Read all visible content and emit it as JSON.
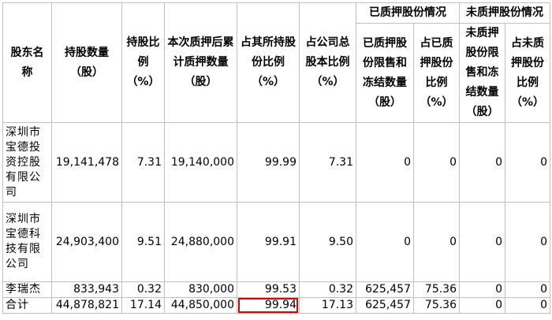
{
  "table": {
    "headers": {
      "shareholder_name": "股东名称",
      "shares_held": "持股数量（股）",
      "holding_ratio": "持股比例（%）",
      "cumulative_pledged": "本次质押后累计质押数量（股）",
      "pct_of_own_holding": "占其所持股份比例（%）",
      "pct_of_total_capital": "占公司总股本比例（%）",
      "pledged_group": "已质押股份情况",
      "unpledged_group": "未质押股份情况",
      "pledged_restricted_frozen": "已质押股份限售和冻结数量（股）",
      "pledged_ratio": "占已质押股份比例（%）",
      "unpledged_restricted_frozen": "未质押股份限售和冻结数量（股）",
      "unpledged_ratio": "占未质押股份比例（%）"
    },
    "rows": [
      {
        "name": "深圳市宝德投资控股有限公司",
        "shares": "19,141,478",
        "ratio": "7.31",
        "pledged": "19,140,000",
        "pct_own": "99.99",
        "pct_total": "7.31",
        "p_restricted": "0",
        "p_ratio": "0",
        "u_restricted": "0",
        "u_ratio": "0"
      },
      {
        "name": "深圳市宝德科技有限公司",
        "shares": "24,903,400",
        "ratio": "9.51",
        "pledged": "24,880,000",
        "pct_own": "99.91",
        "pct_total": "9.50",
        "p_restricted": "0",
        "p_ratio": "0",
        "u_restricted": "0",
        "u_ratio": "0"
      },
      {
        "name": "李瑞杰",
        "shares": "833,943",
        "ratio": "0.32",
        "pledged": "830,000",
        "pct_own": "99.53",
        "pct_total": "0.32",
        "p_restricted": "625,457",
        "p_ratio": "75.36",
        "u_restricted": "0",
        "u_ratio": "0"
      },
      {
        "name": "合计",
        "shares": "44,878,821",
        "ratio": "17.14",
        "pledged": "44,850,000",
        "pct_own": "99.94",
        "pct_total": "17.13",
        "p_restricted": "625,457",
        "p_ratio": "75.36",
        "u_restricted": "0",
        "u_ratio": "0"
      }
    ],
    "highlight_color": "#e00000"
  }
}
